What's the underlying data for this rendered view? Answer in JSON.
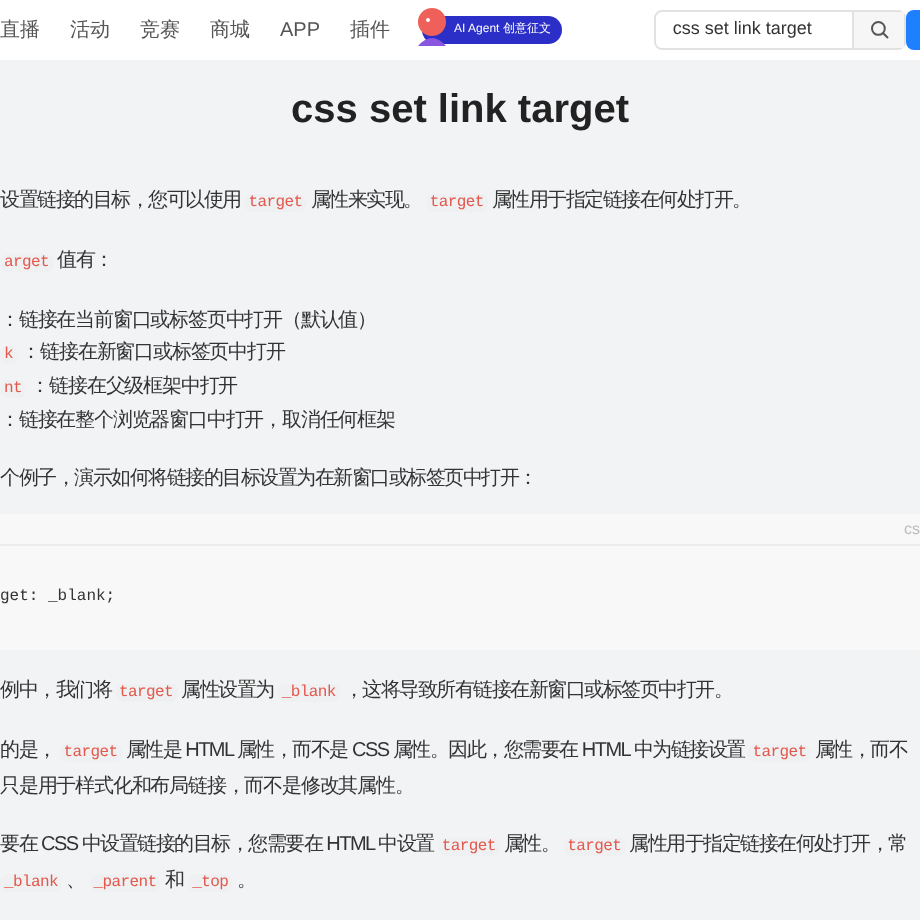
{
  "nav": {
    "items": [
      {
        "label": "直播"
      },
      {
        "label": "活动"
      },
      {
        "label": "竞赛"
      },
      {
        "label": "商城"
      },
      {
        "label": "APP"
      },
      {
        "label": "插件"
      }
    ],
    "badge": "AI Agent 创意征文",
    "search": {
      "value": "css set link target"
    }
  },
  "article": {
    "title": "css set link target",
    "blocks": [
      {
        "kind": "para",
        "segments": [
          {
            "kind": "text",
            "text": "设置链接的目标，您可以使用 "
          },
          {
            "kind": "code",
            "text": "target"
          },
          {
            "kind": "text",
            "text": " 属性来实现。 "
          },
          {
            "kind": "code",
            "text": "target"
          },
          {
            "kind": "text",
            "text": " 属性用于指定链接在何处打开。"
          }
        ]
      },
      {
        "kind": "para",
        "segments": [
          {
            "kind": "code",
            "text": "arget"
          },
          {
            "kind": "text",
            "text": " 值有："
          }
        ]
      },
      {
        "kind": "list",
        "items": [
          [
            {
              "kind": "text",
              "text": "：链接在当前窗口或标签页中打开（默认值）"
            }
          ],
          [
            {
              "kind": "code",
              "text": "k"
            },
            {
              "kind": "text",
              "text": " ：链接在新窗口或标签页中打开"
            }
          ],
          [
            {
              "kind": "code",
              "text": "nt"
            },
            {
              "kind": "text",
              "text": " ：链接在父级框架中打开"
            }
          ],
          [
            {
              "kind": "text",
              "text": "：链接在整个浏览器窗口中打开，取消任何框架"
            }
          ]
        ]
      },
      {
        "kind": "para",
        "segments": [
          {
            "kind": "text",
            "text": "个例子，演示如何将链接的目标设置为在新窗口或标签页中打开："
          }
        ]
      },
      {
        "kind": "codeblock",
        "lang": "cs",
        "lines": [
          "get: _blank;"
        ]
      },
      {
        "kind": "para",
        "segments": [
          {
            "kind": "text",
            "text": "例中，我们将 "
          },
          {
            "kind": "code",
            "text": "target"
          },
          {
            "kind": "text",
            "text": " 属性设置为 "
          },
          {
            "kind": "code",
            "text": "_blank"
          },
          {
            "kind": "text",
            "text": " ，这将导致所有链接在新窗口或标签页中打开。"
          }
        ]
      },
      {
        "kind": "para",
        "segments": [
          {
            "kind": "text",
            "text": "的是， "
          },
          {
            "kind": "code",
            "text": "target"
          },
          {
            "kind": "text",
            "text": " 属性是 HTML 属性，而不是 CSS 属性。因此，您需要在 HTML 中为链接设置 "
          },
          {
            "kind": "code",
            "text": "target"
          },
          {
            "kind": "text",
            "text": " 属性，而不"
          }
        ]
      },
      {
        "kind": "cont",
        "segments": [
          {
            "kind": "text",
            "text": "只是用于样式化和布局链接，而不是修改其属性。"
          }
        ]
      },
      {
        "kind": "para",
        "segments": [
          {
            "kind": "text",
            "text": "要在 CSS 中设置链接的目标，您需要在 HTML 中设置 "
          },
          {
            "kind": "code",
            "text": "target"
          },
          {
            "kind": "text",
            "text": " 属性。 "
          },
          {
            "kind": "code",
            "text": "target"
          },
          {
            "kind": "text",
            "text": " 属性用于指定链接在何处打开，常"
          }
        ]
      },
      {
        "kind": "cont",
        "segments": [
          {
            "kind": "code",
            "text": "_blank"
          },
          {
            "kind": "text",
            "text": " 、 "
          },
          {
            "kind": "code",
            "text": "_parent"
          },
          {
            "kind": "text",
            "text": " 和 "
          },
          {
            "kind": "code",
            "text": "_top"
          },
          {
            "kind": "text",
            "text": " 。"
          }
        ]
      }
    ]
  }
}
